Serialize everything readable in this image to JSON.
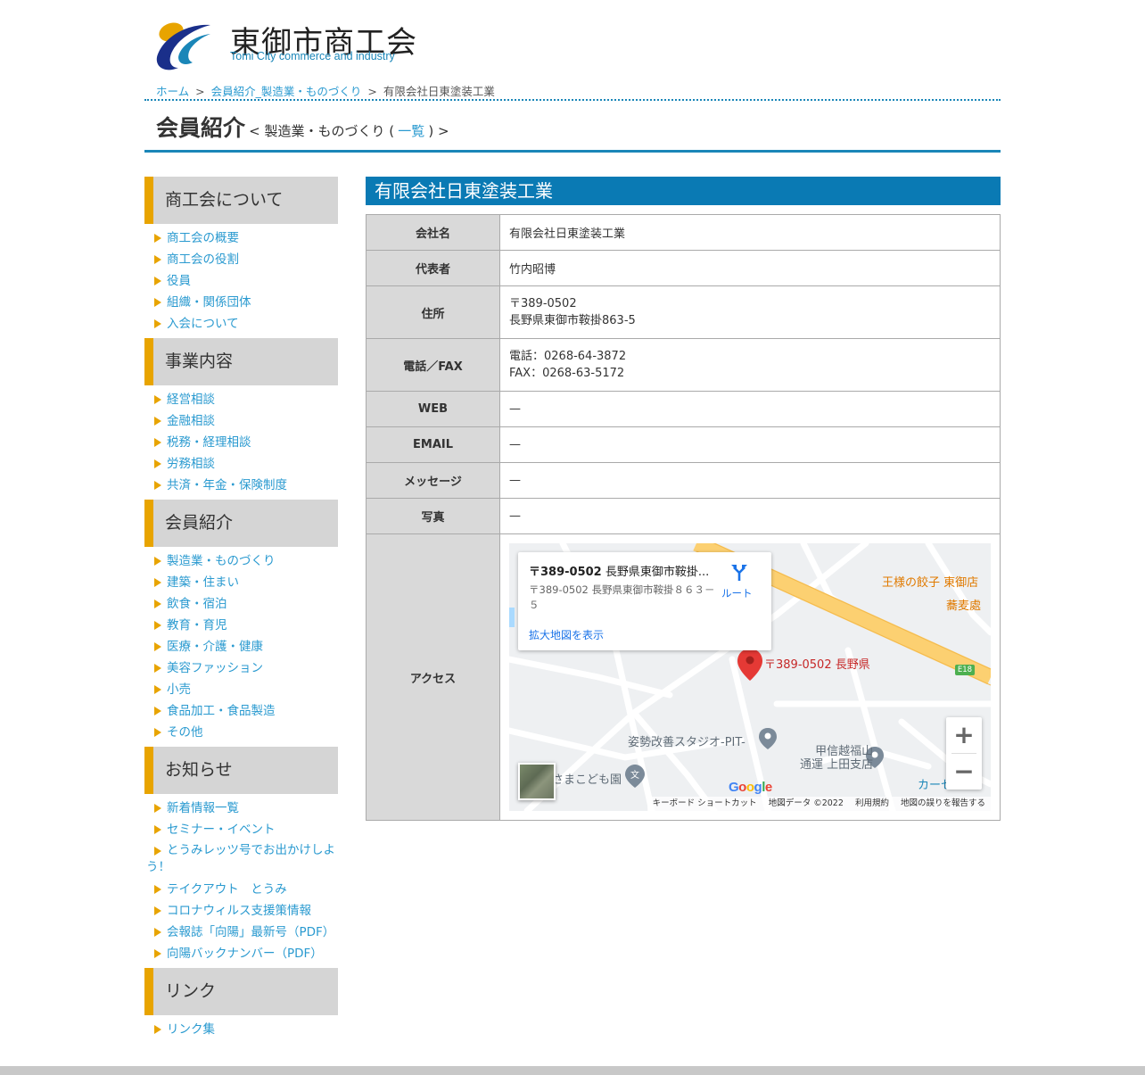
{
  "header": {
    "title": "東御市商工会",
    "subtitle": "Tomi City commerce and industry"
  },
  "breadcrumb": {
    "home": "ホーム",
    "category": "会員紹介_製造業・ものづくり",
    "current": "有限会社日東塗装工業",
    "separator": ">"
  },
  "page_head": {
    "title": "会員紹介",
    "sub_open": "< 製造業・ものづくり (",
    "list_link": "一覧",
    "sub_close": ") >"
  },
  "sidebar": {
    "sections": [
      {
        "heading": "商工会について",
        "items": [
          "商工会の概要",
          "商工会の役割",
          "役員",
          "組織・関係団体",
          "入会について"
        ]
      },
      {
        "heading": "事業内容",
        "items": [
          "経営相談",
          "金融相談",
          "税務・経理相談",
          "労務相談",
          "共済・年金・保険制度"
        ]
      },
      {
        "heading": "会員紹介",
        "items": [
          "製造業・ものづくり",
          "建築・住まい",
          "飲食・宿泊",
          "教育・育児",
          "医療・介護・健康",
          "美容ファッション",
          "小売",
          "食品加工・食品製造",
          "その他"
        ]
      },
      {
        "heading": "お知らせ",
        "items": [
          "新着情報一覧",
          "セミナー・イベント",
          "とうみレッツ号でお出かけしよう！",
          "テイクアウト　とうみ",
          "コロナウィルス支援策情報",
          "会報誌「向陽」最新号（PDF）",
          "向陽バックナンバー（PDF）"
        ]
      },
      {
        "heading": "リンク",
        "items": [
          "リンク集"
        ]
      }
    ]
  },
  "main": {
    "title": "有限会社日東塗装工業",
    "rows": {
      "company_label": "会社名",
      "company_value": "有限会社日東塗装工業",
      "rep_label": "代表者",
      "rep_value": "竹内昭博",
      "address_label": "住所",
      "address_zip": "〒389-0502",
      "address_line": "長野県東御市鞍掛863-5",
      "phone_label": "電話／FAX",
      "phone_value": "電話：0268-64-3872",
      "fax_value": "FAX：0268-63-5172",
      "web_label": "WEB",
      "web_value": "—",
      "email_label": "EMAIL",
      "email_value": "—",
      "message_label": "メッセージ",
      "message_value": "—",
      "photo_label": "写真",
      "photo_value": "—",
      "access_label": "アクセス"
    }
  },
  "map": {
    "card_title_bold": "〒389-0502",
    "card_title_rest": " 長野県東御市鞍掛...",
    "card_address": "〒389-0502 長野県東御市鞍掛８６３－５",
    "card_link": "拡大地図を表示",
    "route_label": "ルート",
    "pin_label": "〒389-0502 長野県",
    "poi_gyoza": "王様の餃子 東御店",
    "poi_soba": "蕎麦處",
    "poi_studio": "姿勢改善スタジオ-PIT-",
    "poi_post_1": "甲信越福山",
    "poi_post_2": "通運 上田支店",
    "poi_kids": "さまこども園",
    "poi_car": "カーセ",
    "road_badge": "E18",
    "google_logo": "Google",
    "footer_shortcuts": "キーボード ショートカット",
    "footer_data": "地図データ ©2022",
    "footer_terms": "利用規約",
    "footer_report": "地図の誤りを報告する",
    "colors": {
      "road_major": "#fcd071",
      "pin": "#e53935",
      "poi_orange": "#e07a00",
      "water": "#aadaff"
    }
  }
}
